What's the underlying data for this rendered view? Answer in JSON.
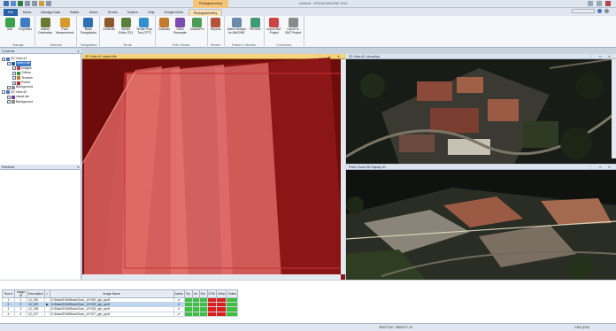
{
  "window": {
    "title": "Untitled1 - ERDAS IMAGINE 2014",
    "context_tab": "Photogrammetry"
  },
  "ribbon_tabs": [
    "File",
    "Home",
    "Manage Data",
    "Raster",
    "Vector",
    "Terrain",
    "Toolbox",
    "Help",
    "Google Earth",
    "Photogrammetry"
  ],
  "ribbon_groups": [
    {
      "label": "Manage",
      "buttons": [
        "Add",
        "Properties"
      ]
    },
    {
      "label": "Measure",
      "buttons": [
        "Interior\nOrientation",
        "Point\nMeasurement"
      ]
    },
    {
      "label": "Triangulation",
      "buttons": [
        "Block\nTriangulation"
      ]
    },
    {
      "label": "Terrain",
      "buttons": [
        "Generate",
        "Terrain\nEditor (TE)",
        "Terrain Prep\nTool (TPT)"
      ]
    },
    {
      "label": "Ortho Mosaic",
      "buttons": [
        "Calibrate",
        "Ortho\nResample",
        "MosaicPro"
      ]
    },
    {
      "label": "Review",
      "buttons": [
        "Reports"
      ]
    },
    {
      "label": "Feature Collection",
      "buttons": [
        "Stereo Analyst\nfor IMAGINE",
        "PRO600"
      ]
    },
    {
      "label": "Conversion",
      "buttons": [
        "Import BAT\nProject",
        "Export to\nISAT Project"
      ]
    }
  ],
  "panels": {
    "contents": "Contents",
    "retriever": "Retriever",
    "view2d": "2D View #1: salem.blk",
    "view3d": "2D View #2: visual.las",
    "pointcloud": "Point Cloud 3D Display #1",
    "images": "Images"
  },
  "tree": [
    {
      "label": "2D View #1",
      "depth": 0,
      "icon": "view-icon"
    },
    {
      "label": "salem.blk",
      "depth": 1,
      "icon": "block-icon",
      "selected": true
    },
    {
      "label": "Images",
      "depth": 2,
      "icon": "images-icon"
    },
    {
      "label": "Orthos",
      "depth": 2,
      "icon": "orthos-icon"
    },
    {
      "label": "Terrains",
      "depth": 2,
      "icon": "terrains-icon"
    },
    {
      "label": "Points",
      "depth": 2,
      "icon": "points-icon"
    },
    {
      "label": "Background",
      "depth": 1,
      "icon": "background-icon"
    },
    {
      "label": "2D View #2",
      "depth": 0,
      "icon": "view-icon"
    },
    {
      "label": "visual.las",
      "depth": 1,
      "icon": "las-icon"
    },
    {
      "label": "Background",
      "depth": 1,
      "icon": "background-icon"
    }
  ],
  "table": {
    "headers": [
      "Row #",
      "Image ID",
      "Description",
      ">",
      "Image Name",
      "Active",
      "Pyr.",
      "Int.",
      "Ext.",
      "DTM",
      "Ortho",
      "Online"
    ],
    "rows": [
      {
        "row": "1",
        "id": "1",
        "desc": "12_030",
        "mark": "",
        "name": "D:/Data/SGM/Block/Gom_12^030_rgb_ap.tif",
        "active": "✔",
        "status": [
          "green",
          "green",
          "green",
          "red",
          "red",
          "green"
        ],
        "selected": false
      },
      {
        "row": "2",
        "id": "2",
        "desc": "12_029",
        "mark": "▶",
        "name": "D:/Data/SGM/Block/Gom_12^029_rgb_ap.tif",
        "active": "✔",
        "status": [
          "green",
          "green",
          "green",
          "red",
          "red",
          "green"
        ],
        "selected": true
      },
      {
        "row": "3",
        "id": "3",
        "desc": "12_028",
        "mark": "",
        "name": "D:/Data/SGM/Block/Gom_12^028_rgb_ap.tif",
        "active": "✔",
        "status": [
          "green",
          "green",
          "green",
          "red",
          "red",
          "green"
        ],
        "selected": false
      },
      {
        "row": "4",
        "id": "4",
        "desc": "12_027",
        "mark": "",
        "name": "D:/Data/SGM/Block/Gom_12^027_rgb_ap.tif",
        "active": "✔",
        "status": [
          "green",
          "green",
          "green",
          "red",
          "red",
          "green"
        ],
        "selected": false
      }
    ]
  },
  "status": {
    "coords": "350273.87, 5562317.20",
    "srs": "IGIB (CW)"
  },
  "colors": {
    "green": "#3fbf3f",
    "red": "#e01b1b",
    "accent": "#2b5fa8"
  }
}
